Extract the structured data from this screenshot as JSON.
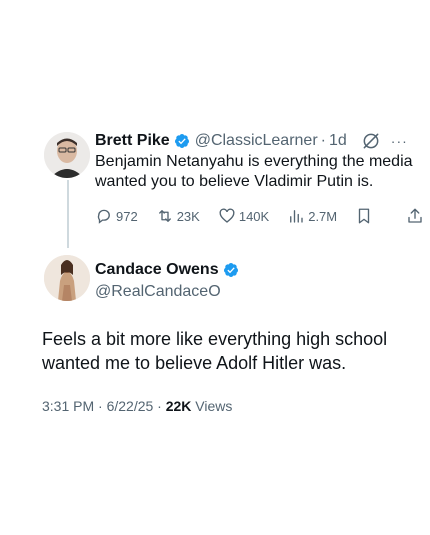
{
  "reply": {
    "name": "Brett Pike",
    "handle": "@ClassicLearner",
    "time": "1d",
    "text": "Benjamin Netanyahu is everything the media wanted you to believe Vladimir Putin is.",
    "more_label": "···",
    "stats": {
      "replies": "972",
      "reposts": "23K",
      "likes": "140K",
      "views": "2.7M"
    }
  },
  "main": {
    "name": "Candace Owens",
    "handle": "@RealCandaceO",
    "text": "Feels a bit more like everything high school wanted me to believe Adolf Hitler was.",
    "timestamp": "3:31 PM · 6/22/25 · ",
    "views_count": "22K",
    "views_label": " Views"
  },
  "colors": {
    "verified": "#1d9bf0",
    "muted": "#536471",
    "text": "#0f1419"
  }
}
